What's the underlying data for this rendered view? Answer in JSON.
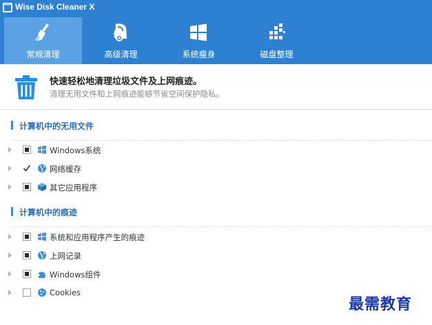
{
  "window": {
    "title": "Wise Disk Cleaner X",
    "app_icon": "broom-app-icon"
  },
  "nav": {
    "tabs": [
      {
        "label": "常规清理",
        "icon": "broom-icon",
        "active": true
      },
      {
        "label": "高级清理",
        "icon": "vacuum-cleaner-icon",
        "active": false
      },
      {
        "label": "系统瘦身",
        "icon": "windows-logo-icon",
        "active": false
      },
      {
        "label": "磁盘整理",
        "icon": "defrag-blocks-icon",
        "active": false
      }
    ]
  },
  "banner": {
    "title": "快速轻松地清理垃圾文件及上网痕迹。",
    "subtitle": "清理无用文件和上网痕迹能够节省空间保护隐私。",
    "icon": "trash-can-icon"
  },
  "sections": [
    {
      "title": "计算机中的无用文件",
      "items": [
        {
          "label": "Windows系统",
          "icon": "windows-flag-icon",
          "check_state": "partial"
        },
        {
          "label": "网络缓存",
          "icon": "globe-icon",
          "check_state": "checked"
        },
        {
          "label": "其它应用程序",
          "icon": "box-icon",
          "check_state": "partial"
        }
      ]
    },
    {
      "title": "计算机中的痕迹",
      "items": [
        {
          "label": "系统和应用程序产生的痕迹",
          "icon": "windows-flag-icon",
          "check_state": "partial"
        },
        {
          "label": "上网记录",
          "icon": "globe-icon",
          "check_state": "partial"
        },
        {
          "label": "Windows组件",
          "icon": "puzzle-icon",
          "check_state": "partial"
        },
        {
          "label": "Cookies",
          "icon": "cookie-icon",
          "check_state": "unchecked"
        }
      ]
    }
  ],
  "watermark": {
    "text": "最需教育"
  },
  "colors": {
    "header_blue": "#2d80d2",
    "active_tab": "#5aa2e3",
    "section_title": "#2c6fb4",
    "watermark": "#1a3aa0"
  }
}
